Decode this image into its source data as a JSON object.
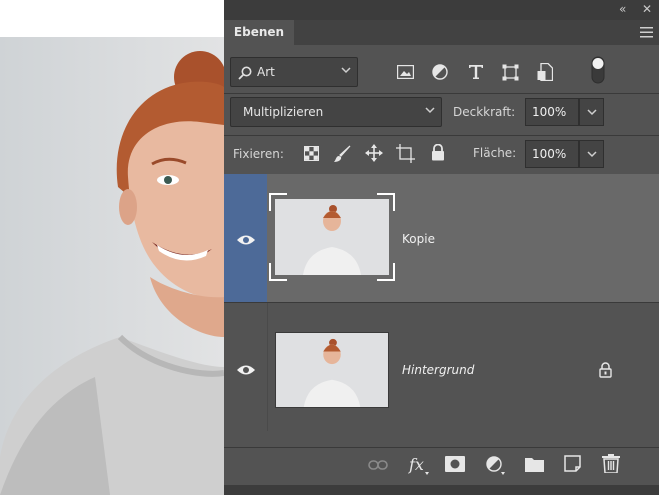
{
  "panel": {
    "tab_title": "Ebenen",
    "collapse_glyph": "«",
    "close_glyph": "✕",
    "colors": {
      "panel_bg": "#535353",
      "selected_layer": "#696969",
      "eye_selected_bg": "#4d6a98"
    }
  },
  "filter": {
    "kind_label": "Art",
    "icons": [
      "search-icon",
      "image-filter-icon",
      "adjustment-filter-icon",
      "type-filter-icon",
      "shape-filter-icon",
      "smart-object-filter-icon",
      "filter-toggle-switch"
    ]
  },
  "blend": {
    "mode_label": "Multiplizieren",
    "opacity_label": "Deckkraft:",
    "opacity_value": "100%"
  },
  "lock": {
    "label": "Fixieren:",
    "icons": [
      "lock-transparent-pixels-icon",
      "lock-image-pixels-icon",
      "lock-position-icon",
      "lock-artboard-icon",
      "lock-all-icon"
    ],
    "fill_label": "Fläche:",
    "fill_value": "100%"
  },
  "layers": [
    {
      "name": "Kopie",
      "visible": true,
      "selected": true,
      "locked": false,
      "italic": false
    },
    {
      "name": "Hintergrund",
      "visible": true,
      "selected": false,
      "locked": true,
      "italic": true
    }
  ],
  "bottom_actions": [
    "link-layers-icon",
    "fx-icon",
    "add-mask-icon",
    "new-adjustment-icon",
    "new-group-icon",
    "new-layer-icon",
    "delete-layer-icon"
  ]
}
